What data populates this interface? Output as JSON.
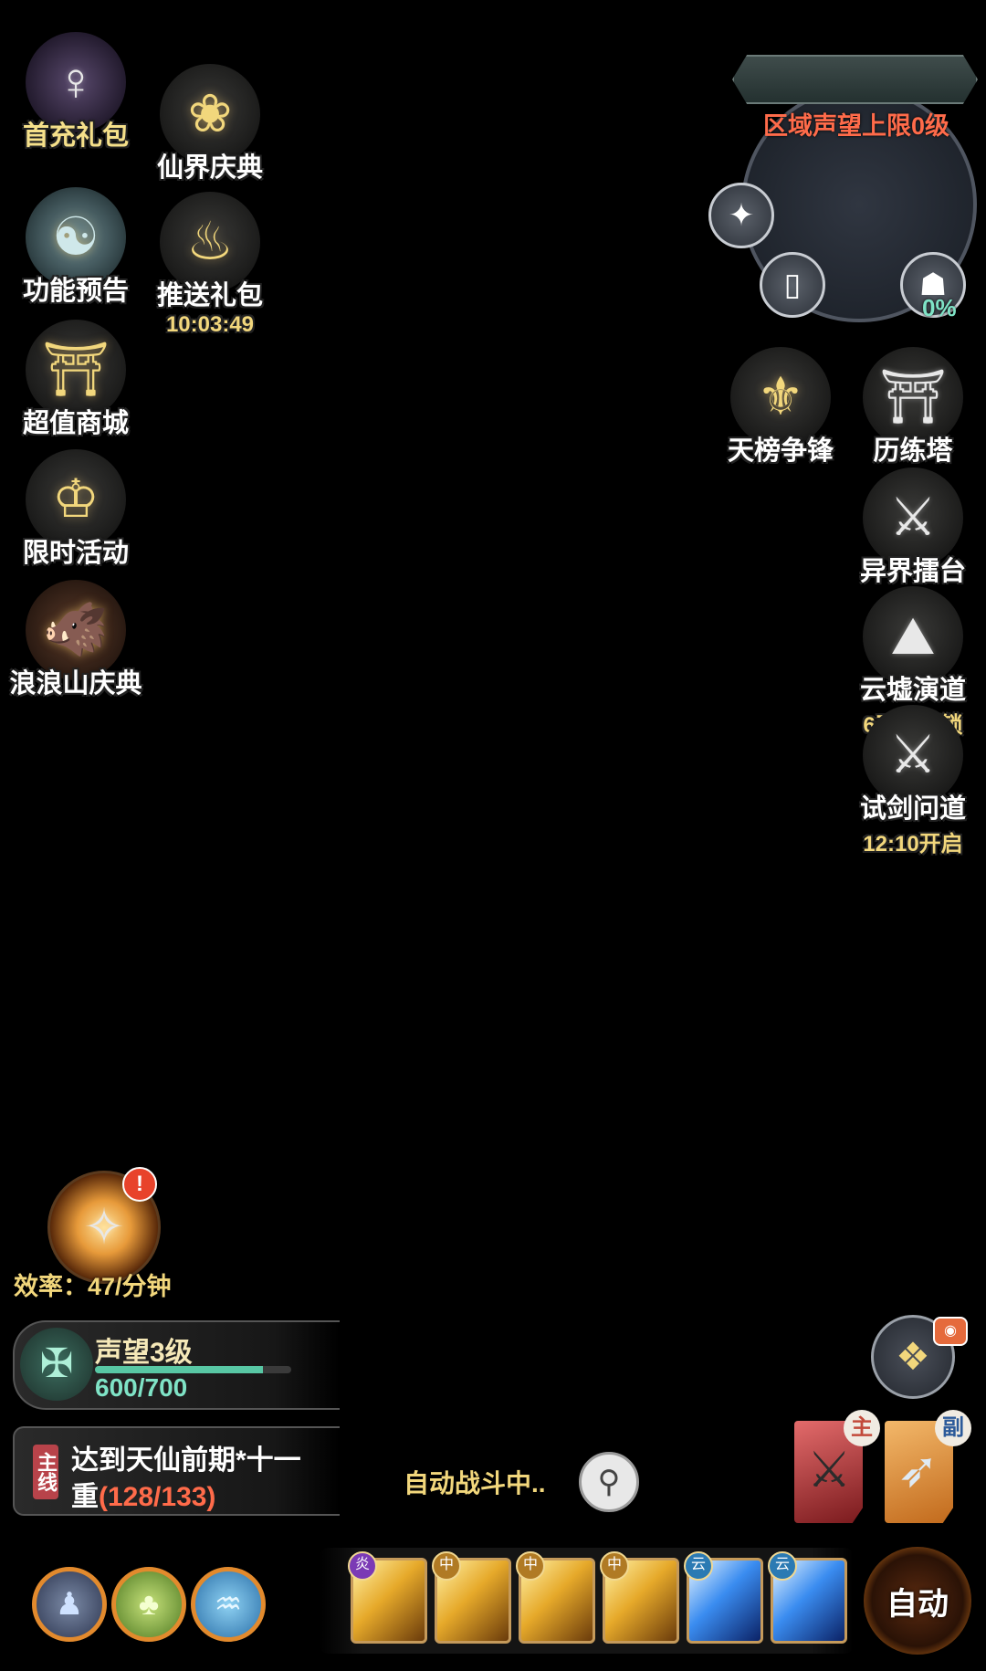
{
  "left_menu": [
    {
      "id": "first_charge",
      "label": "首充礼包",
      "icon": "girl-avatar-icon"
    },
    {
      "id": "celebration",
      "label": "仙界庆典",
      "icon": "gift-box-icon"
    },
    {
      "id": "preview",
      "label": "功能预告",
      "icon": "swirl-icon"
    },
    {
      "id": "push_pack",
      "label": "推送礼包",
      "timer": "10:03:49",
      "icon": "money-bag-icon"
    },
    {
      "id": "shop",
      "label": "超值商城",
      "icon": "shop-gate-icon"
    },
    {
      "id": "limited",
      "label": "限时活动",
      "icon": "treasure-icon"
    },
    {
      "id": "langlang",
      "label": "浪浪山庆典",
      "icon": "boar-mascot-icon"
    }
  ],
  "minimap": {
    "region_text": "区域声望上限0级",
    "progress_text": "0%"
  },
  "right_menu": [
    {
      "id": "tianbang",
      "label": "天榜争锋",
      "icon": "sword-crest-icon"
    },
    {
      "id": "tower",
      "label": "历练塔",
      "icon": "pagoda-icon"
    },
    {
      "id": "arena",
      "label": "异界擂台",
      "icon": "arena-icon"
    },
    {
      "id": "yunxu",
      "label": "云墟演道",
      "sub": "6天后解锁",
      "icon": "crane-icon"
    },
    {
      "id": "shijian",
      "label": "试剑问道",
      "sub": "12:10开启",
      "icon": "crossed-swords-icon"
    }
  ],
  "efficiency": {
    "text": "效率：47/分钟",
    "alert": "!"
  },
  "reputation": {
    "title": "声望3级",
    "value": "600/700",
    "fraction": 0.857
  },
  "quest": {
    "tag": "主线",
    "line1": "达到天仙前期*十一",
    "line2_prefix": "重",
    "line2_progress": "(128/133)"
  },
  "auto_status": "自动战斗中..",
  "weapons": {
    "main_tag": "主",
    "sub_tag": "副"
  },
  "auto_button": "自动",
  "skill_badges": [
    "炎",
    "中",
    "中",
    "中",
    "云",
    "云"
  ],
  "colors": {
    "gold": "#f2d77c",
    "red_text": "#ff6b4a",
    "teal_bar": "#58c7a4"
  }
}
